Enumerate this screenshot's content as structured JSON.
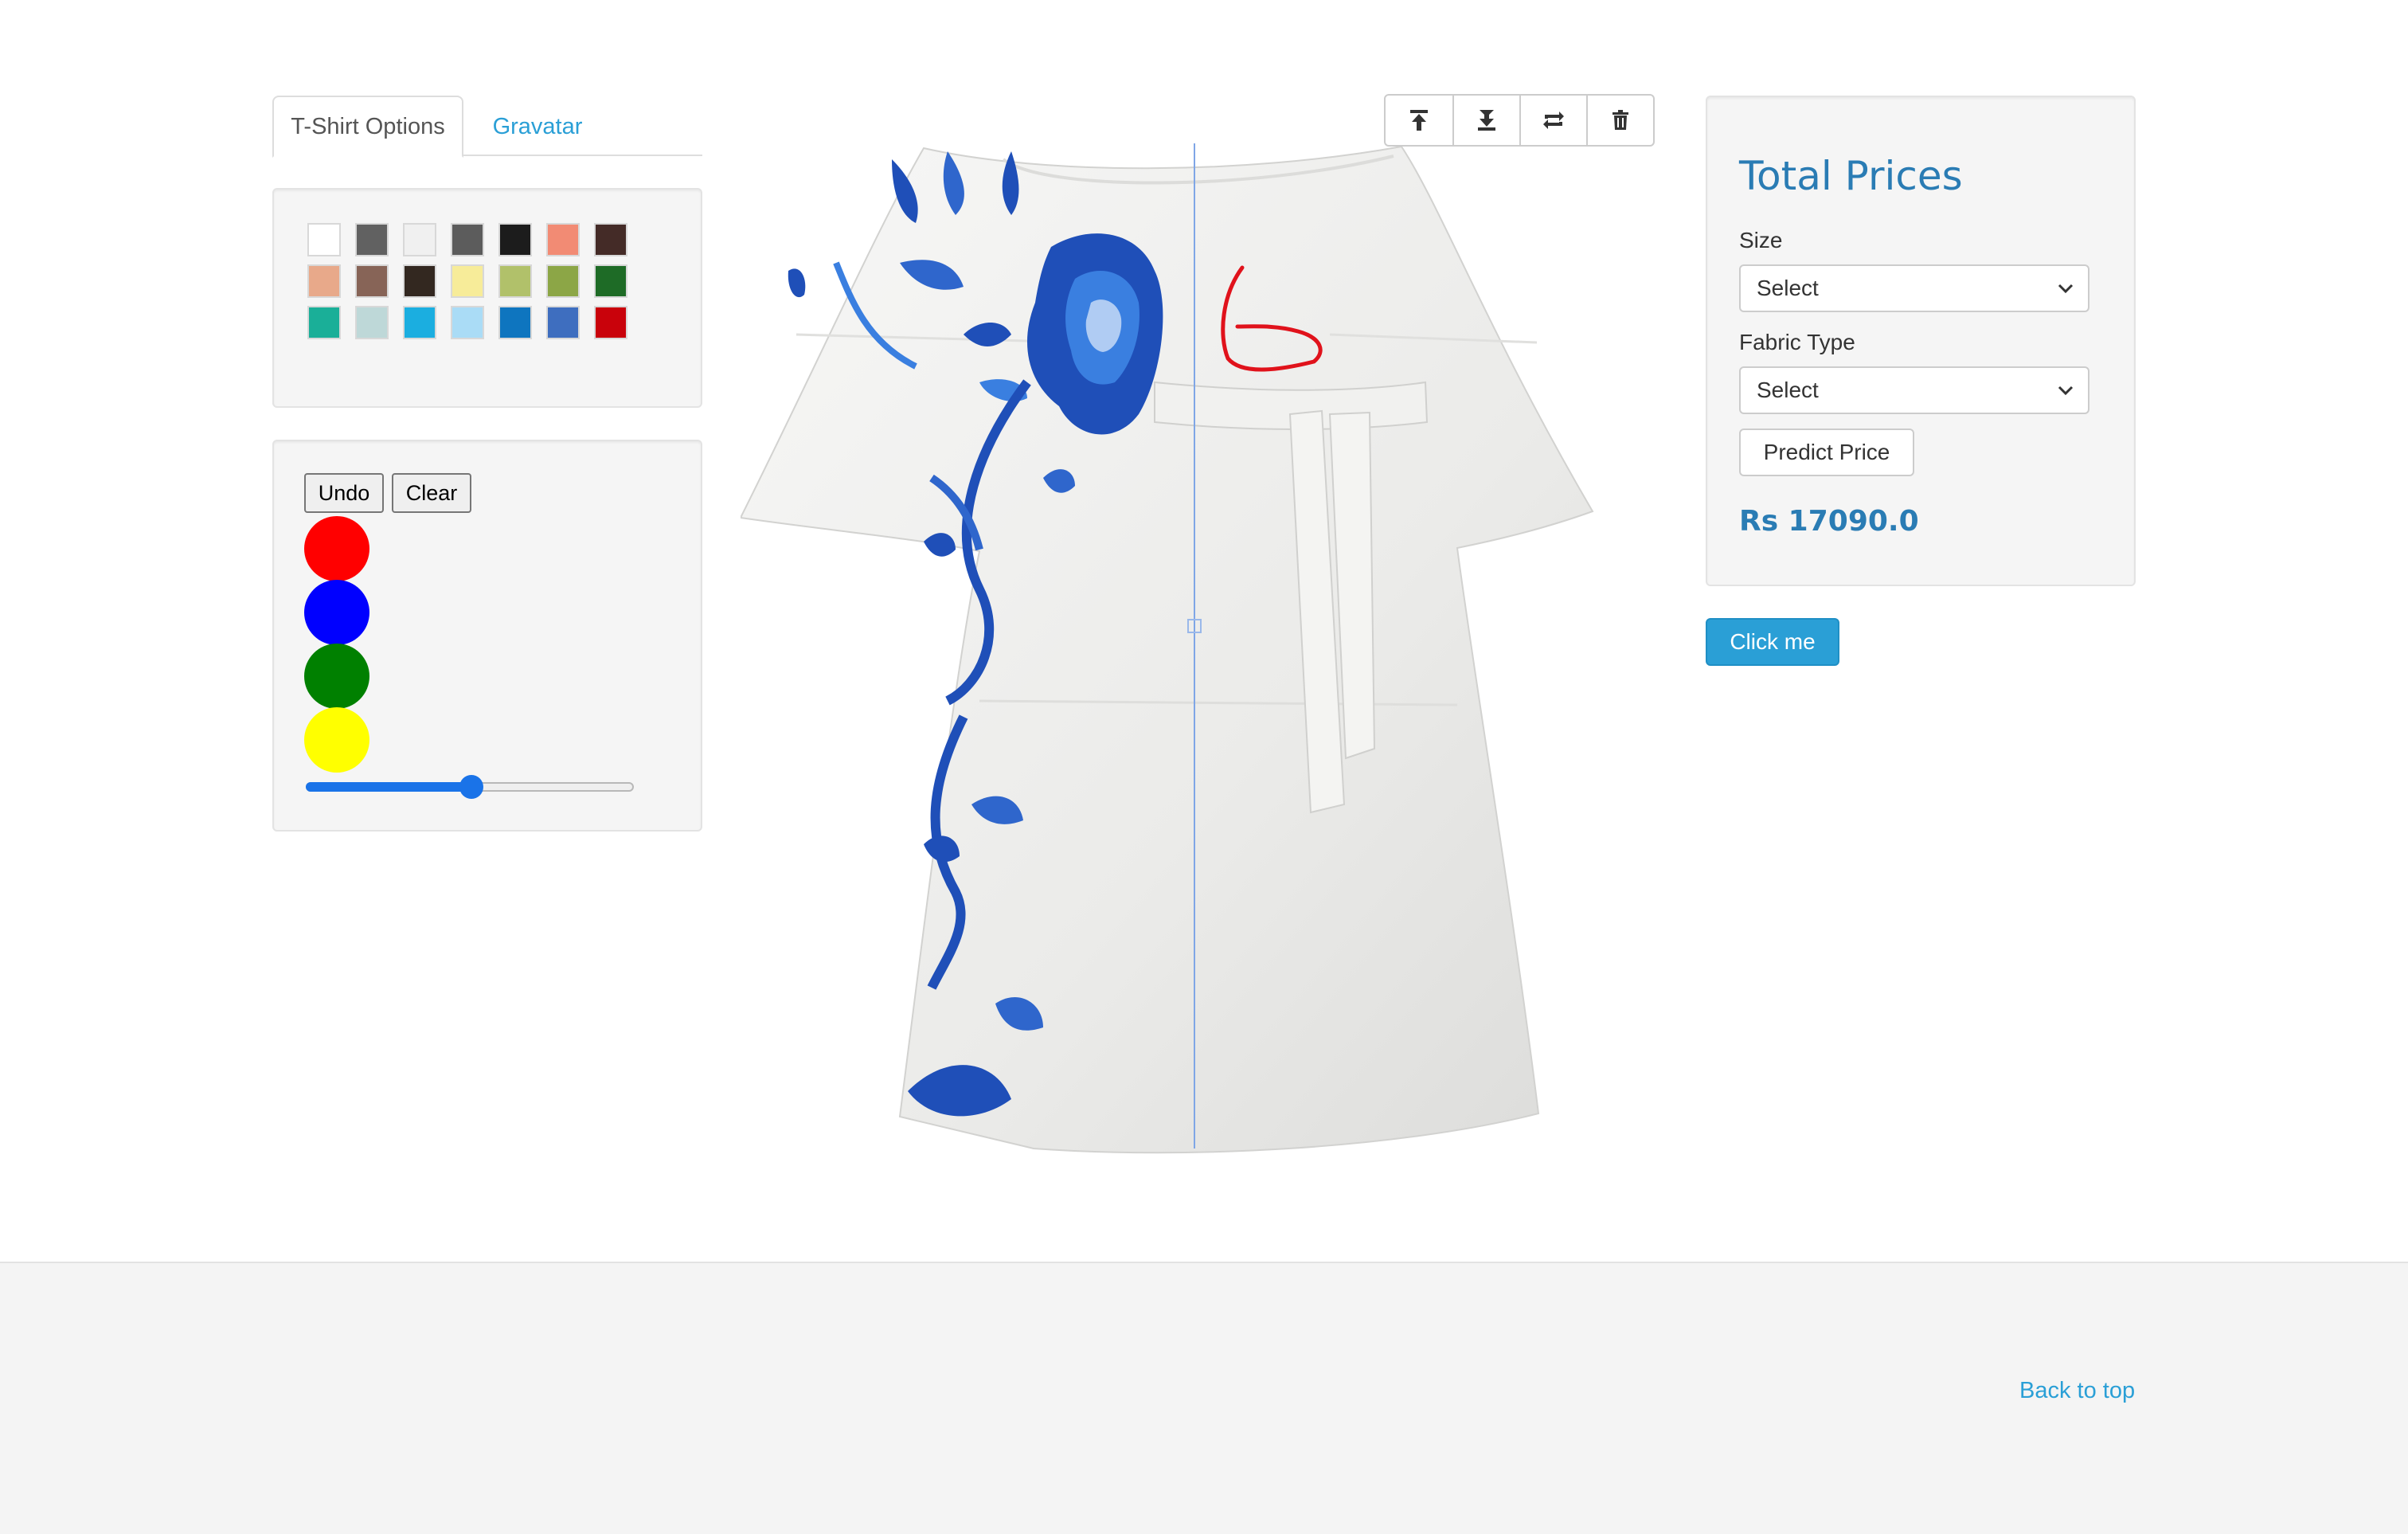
{
  "tabs": [
    {
      "label": "T-Shirt Options",
      "active": true
    },
    {
      "label": "Gravatar",
      "active": false
    }
  ],
  "swatches": [
    "#ffffff",
    "#616161",
    "#f0f0f0",
    "#5c5c5c",
    "#1c1c1c",
    "#f28b74",
    "#442b27",
    "#e8a98a",
    "#876457",
    "#332820",
    "#f7ec99",
    "#b1c16a",
    "#8ca646",
    "#1e6b26",
    "#1aaf98",
    "#bed8d8",
    "#1baee0",
    "#aadcf6",
    "#0e75bf",
    "#3e6ebf",
    "#c9020b"
  ],
  "drawing": {
    "undo_label": "Undo",
    "clear_label": "Clear",
    "brush_colors": [
      "#ff0000",
      "#0000ff",
      "#008000",
      "#ffff00"
    ],
    "brush_size": 0.5
  },
  "toolbar": {
    "icons": [
      "bring-to-front-icon",
      "send-to-back-icon",
      "flip-icon",
      "trash-icon"
    ]
  },
  "pricing": {
    "title": "Total Prices",
    "size_label": "Size",
    "size_value": "Select",
    "fabric_label": "Fabric Type",
    "fabric_value": "Select",
    "predict_label": "Predict Price",
    "price": "Rs 17090.0"
  },
  "click_me_label": "Click me",
  "footer": {
    "back_to_top": "Back to top"
  }
}
